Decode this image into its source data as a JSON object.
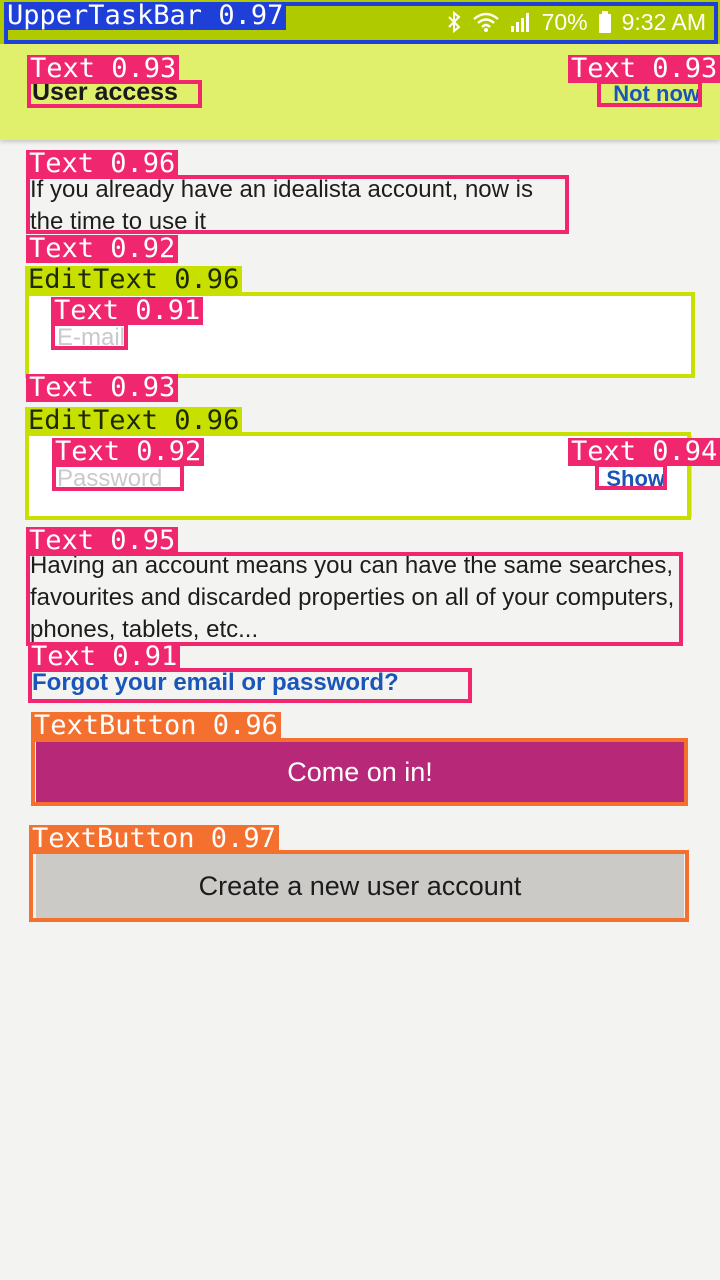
{
  "status_bar": {
    "battery": "70%",
    "time": "9:32 AM",
    "icons": [
      "bluetooth-icon",
      "wifi-icon",
      "signal-icon",
      "battery-icon"
    ]
  },
  "header": {
    "title": "User access",
    "not_now": "Not now"
  },
  "intro": "If you already have an idealista account, now is the time to use it",
  "email_field": {
    "placeholder": "E-mail",
    "value": ""
  },
  "password_field": {
    "placeholder": "Password",
    "value": "",
    "show_label": "Show"
  },
  "info": "Having an account means you can have the same searches, favourites and discarded properties on all of your computers, phones, tablets, etc...",
  "forgot_link": "Forgot your email or password?",
  "buttons": {
    "enter": "Come on in!",
    "create": "Create a new user account"
  },
  "detections": {
    "upper_task_bar": "UpperTaskBar 0.97",
    "title_text": "Text 0.93",
    "not_now_text": "Text 0.93",
    "intro_text": "Text 0.96",
    "email_label_text": "Text 0.92",
    "email_edit": "EditText 0.96",
    "email_placeholder_text": "Text 0.91",
    "password_label_text": "Text 0.93",
    "password_edit": "EditText 0.96",
    "password_placeholder_text": "Text 0.92",
    "show_text": "Text 0.94",
    "info_text": "Text 0.95",
    "forgot_text": "Text 0.91",
    "enter_button": "TextButton 0.96",
    "create_button": "TextButton 0.97"
  },
  "colors": {
    "status_bar": "#afcb00",
    "header": "#e0f06c",
    "link": "#1a56b8",
    "primary_button": "#b82878",
    "secondary_button": "#cbcac6"
  }
}
